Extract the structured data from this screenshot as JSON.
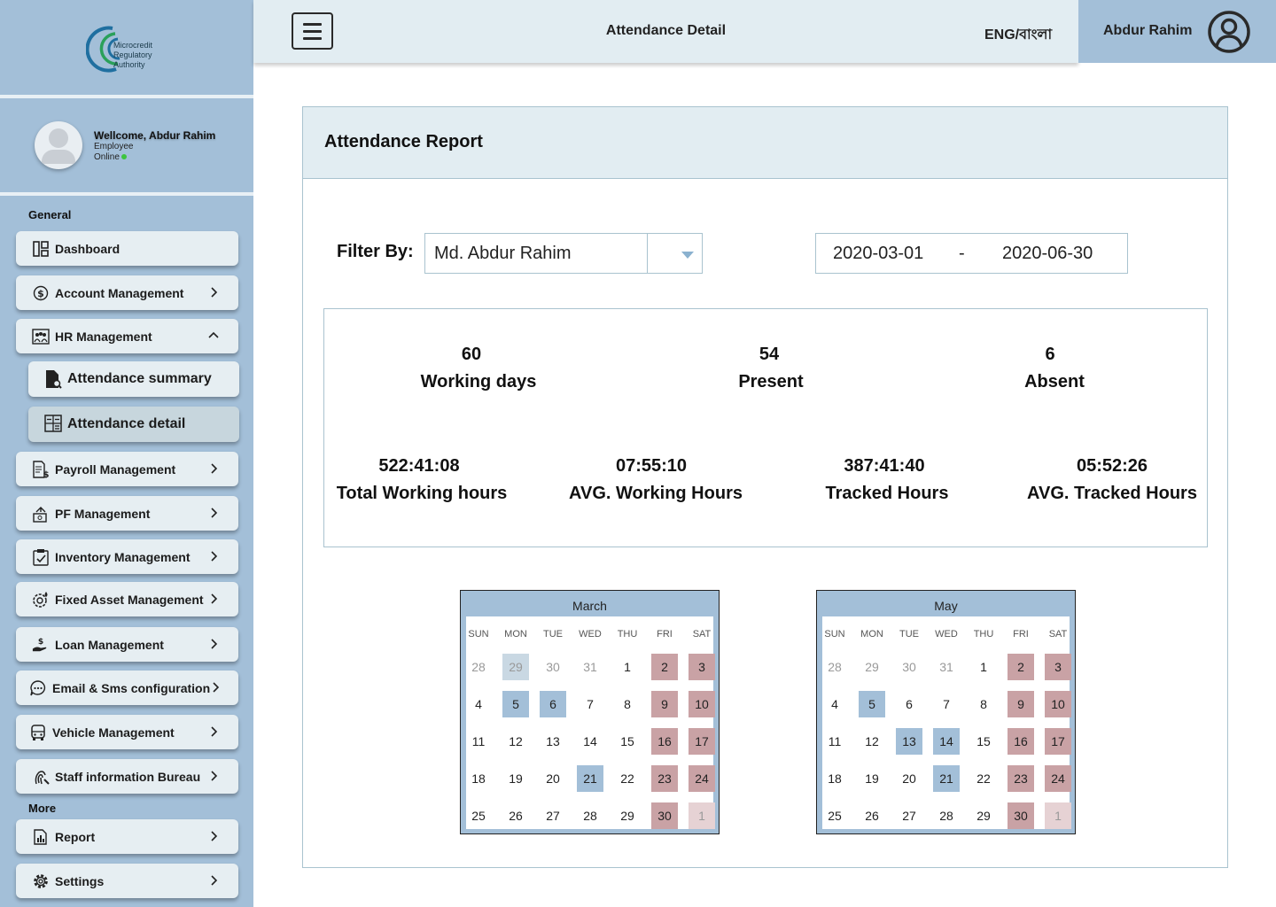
{
  "brand": {
    "logo_lines": [
      "Microcredit",
      "Regulatory",
      "Authority"
    ]
  },
  "profile": {
    "welcome": "Wellcome, Abdur Rahim",
    "role": "Employee",
    "status": "Online"
  },
  "sidebar": {
    "general_title": "General",
    "more_title": "More",
    "items": [
      {
        "label": "Dashboard",
        "icon": "dashboard-icon"
      },
      {
        "label": "Account Management",
        "icon": "dollar-circle-icon"
      },
      {
        "label": "HR Management",
        "icon": "people-board-icon"
      },
      {
        "label": "Payroll Management",
        "icon": "payroll-doc-icon"
      },
      {
        "label": "PF Management",
        "icon": "money-transfer-icon"
      },
      {
        "label": "Inventory Management",
        "icon": "clipboard-check-icon"
      },
      {
        "label": "Fixed Asset Management",
        "icon": "gear-drop-icon"
      },
      {
        "label": "Loan Management",
        "icon": "hand-dollar-icon"
      },
      {
        "label": "Email & Sms configuration",
        "icon": "chat-bubble-icon"
      },
      {
        "label": "Vehicle Management",
        "icon": "bus-icon"
      },
      {
        "label": "Staff information Bureau",
        "icon": "fingerprint-icon"
      }
    ],
    "sub_items": [
      {
        "label": "Attendance summary",
        "icon": "doc-search-icon"
      },
      {
        "label": "Attendance detail",
        "icon": "calculator-icon"
      }
    ],
    "more_items": [
      {
        "label": "Report",
        "icon": "report-icon"
      },
      {
        "label": "Settings",
        "icon": "gear-icon"
      }
    ]
  },
  "topbar": {
    "title": "Attendance Detail",
    "language": "ENG/বাংলা",
    "user_name": "Abdur Rahim"
  },
  "report": {
    "title": "Attendance Report",
    "filter_label": "Filter By:",
    "filter_value": "Md. Abdur Rahim",
    "date_from": "2020-03-01",
    "date_sep": "-",
    "date_to": "2020-06-30",
    "stats_top": [
      {
        "value": "60",
        "label": "Working days"
      },
      {
        "value": "54",
        "label": "Present"
      },
      {
        "value": "6",
        "label": "Absent"
      }
    ],
    "stats_bottom": [
      {
        "value": "522:41:08",
        "label": "Total Working hours"
      },
      {
        "value": "07:55:10",
        "label": "AVG. Working Hours"
      },
      {
        "value": "387:41:40",
        "label": "Tracked Hours"
      },
      {
        "value": "05:52:26",
        "label": "AVG. Tracked Hours"
      }
    ]
  },
  "calendars": [
    {
      "month": "March",
      "dow": [
        "SUN",
        "MON",
        "TUE",
        "WED",
        "THU",
        "FRI",
        "SAT"
      ],
      "weeks": [
        [
          [
            "28",
            "muted"
          ],
          [
            "29",
            "faint"
          ],
          [
            "30",
            "muted"
          ],
          [
            "31",
            "muted"
          ],
          [
            "1",
            ""
          ],
          [
            "2",
            "pink"
          ],
          [
            "3",
            "pink"
          ]
        ],
        [
          [
            "4",
            ""
          ],
          [
            "5",
            "blue"
          ],
          [
            "6",
            "blue"
          ],
          [
            "7",
            ""
          ],
          [
            "8",
            ""
          ],
          [
            "9",
            "pink"
          ],
          [
            "10",
            "pink"
          ]
        ],
        [
          [
            "11",
            ""
          ],
          [
            "12",
            ""
          ],
          [
            "13",
            ""
          ],
          [
            "14",
            ""
          ],
          [
            "15",
            ""
          ],
          [
            "16",
            "pink"
          ],
          [
            "17",
            "pink"
          ]
        ],
        [
          [
            "18",
            ""
          ],
          [
            "19",
            ""
          ],
          [
            "20",
            ""
          ],
          [
            "21",
            "blue"
          ],
          [
            "22",
            ""
          ],
          [
            "23",
            "pink"
          ],
          [
            "24",
            "pink"
          ]
        ],
        [
          [
            "25",
            ""
          ],
          [
            "26",
            ""
          ],
          [
            "27",
            ""
          ],
          [
            "28",
            ""
          ],
          [
            "29",
            ""
          ],
          [
            "30",
            "pink"
          ],
          [
            "1",
            "faintpink"
          ]
        ]
      ]
    },
    {
      "month": "May",
      "dow": [
        "SUN",
        "MON",
        "TUE",
        "WED",
        "THU",
        "FRI",
        "SAT"
      ],
      "weeks": [
        [
          [
            "28",
            "muted"
          ],
          [
            "29",
            "muted"
          ],
          [
            "30",
            "muted"
          ],
          [
            "31",
            "muted"
          ],
          [
            "1",
            ""
          ],
          [
            "2",
            "pink"
          ],
          [
            "3",
            "pink"
          ]
        ],
        [
          [
            "4",
            ""
          ],
          [
            "5",
            "blue"
          ],
          [
            "6",
            ""
          ],
          [
            "7",
            ""
          ],
          [
            "8",
            ""
          ],
          [
            "9",
            "pink"
          ],
          [
            "10",
            "pink"
          ]
        ],
        [
          [
            "11",
            ""
          ],
          [
            "12",
            ""
          ],
          [
            "13",
            "blue"
          ],
          [
            "14",
            "blue"
          ],
          [
            "15",
            ""
          ],
          [
            "16",
            "pink"
          ],
          [
            "17",
            "pink"
          ]
        ],
        [
          [
            "18",
            ""
          ],
          [
            "19",
            ""
          ],
          [
            "20",
            ""
          ],
          [
            "21",
            "blue"
          ],
          [
            "22",
            ""
          ],
          [
            "23",
            "pink"
          ],
          [
            "24",
            "pink"
          ]
        ],
        [
          [
            "25",
            ""
          ],
          [
            "26",
            ""
          ],
          [
            "27",
            ""
          ],
          [
            "28",
            ""
          ],
          [
            "29",
            ""
          ],
          [
            "30",
            "pink"
          ],
          [
            "1",
            "faintpink"
          ]
        ]
      ]
    }
  ],
  "colors": {
    "sidebar": "#a3bfd8",
    "topbar": "#e2edf2",
    "weekend": "#c9a2a5",
    "leave": "#a3bfd8"
  }
}
